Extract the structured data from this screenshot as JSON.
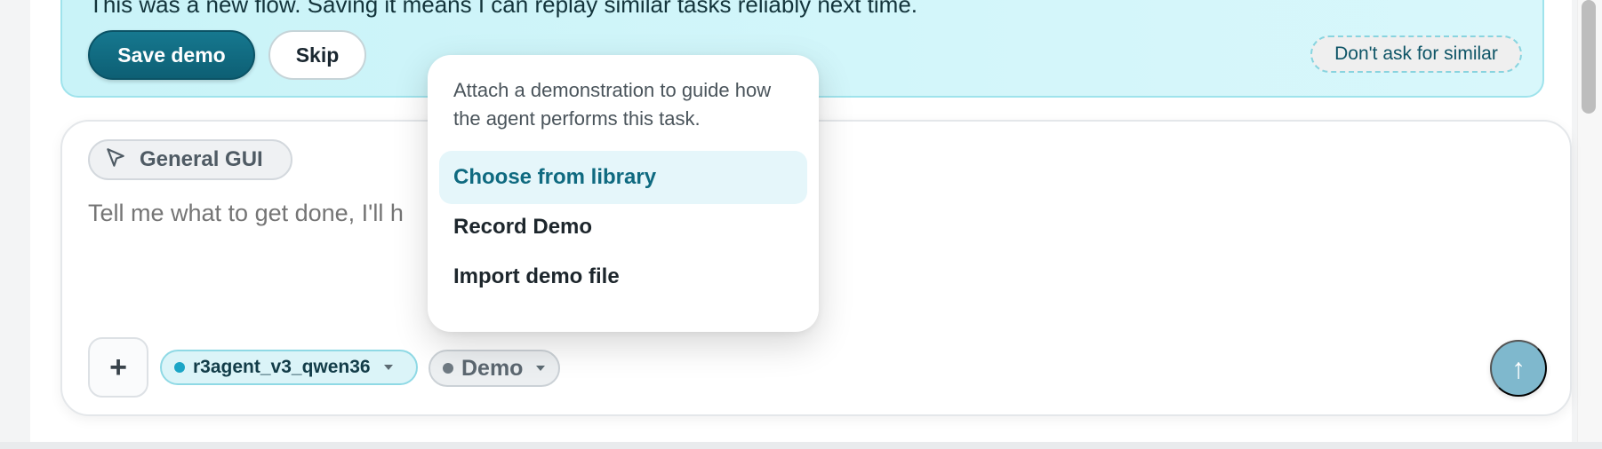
{
  "banner": {
    "message": "This was a new flow. Saving it means I can replay similar tasks reliably next time.",
    "save_label": "Save demo",
    "skip_label": "Skip",
    "dont_ask_label": "Don't ask for similar"
  },
  "composer": {
    "mode_label": "General GUI",
    "prompt_placeholder": "Tell me what to get done, I'll h",
    "add_label": "+",
    "agent_label": "r3agent_v3_qwen36",
    "demo_label": "Demo",
    "send_icon": "↑"
  },
  "demo_menu": {
    "description": "Attach a demonstration to guide how the agent performs this task.",
    "items": [
      {
        "label": "Choose from library"
      },
      {
        "label": "Record Demo"
      },
      {
        "label": "Import demo file"
      }
    ]
  },
  "icons": {
    "mode": "cursor-arrow-icon",
    "send": "arrow-up-icon",
    "add": "plus-icon"
  },
  "colors": {
    "accent": "#0d5f74",
    "banner_bg": "#d3f6fa",
    "active_item_bg": "#e5f6fa",
    "send_bg": "#7fb8cd"
  }
}
